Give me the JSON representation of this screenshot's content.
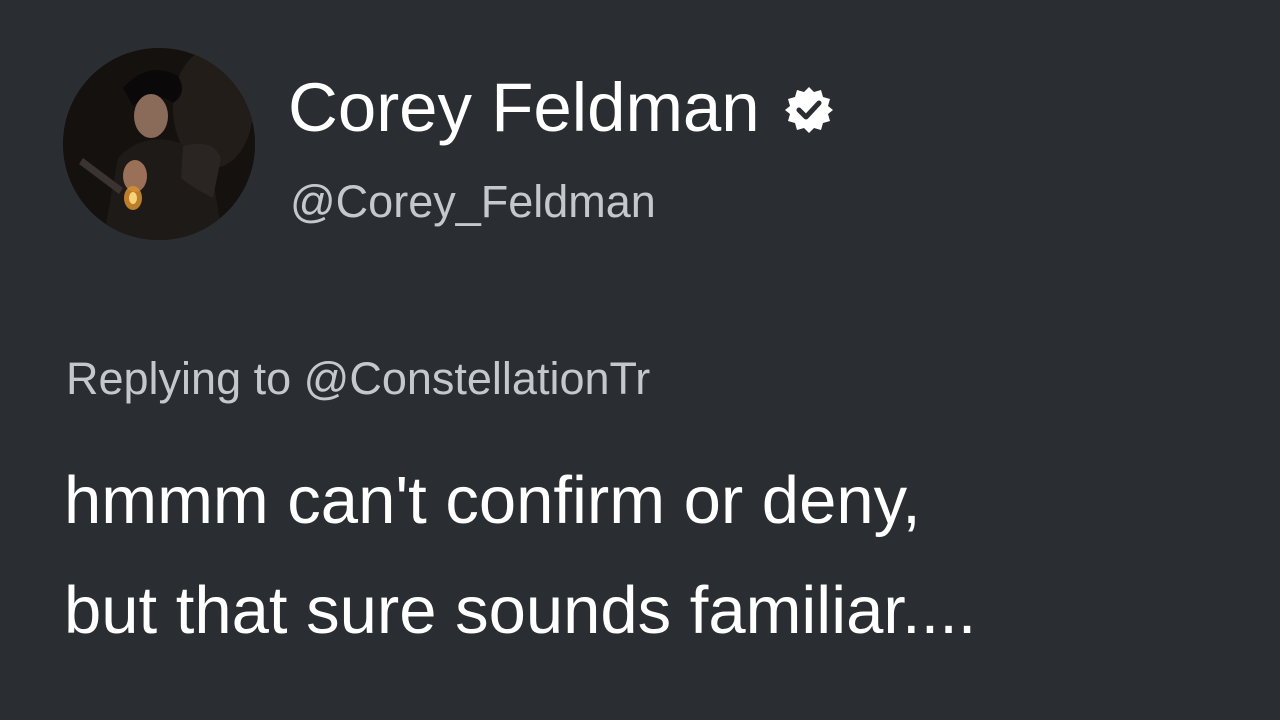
{
  "tweet": {
    "author": {
      "display_name": "Corey Feldman",
      "handle": "@Corey_Feldman",
      "verified": true,
      "verified_icon": "verified-badge-icon",
      "avatar": "profile-photo"
    },
    "reply": {
      "prefix": "Replying to",
      "to_handle": "@ConstellationTr"
    },
    "text_lines": [
      "hmmm can't confirm or deny,",
      "but that sure sounds familiar...."
    ]
  },
  "colors": {
    "background": "#2a2d31",
    "primary_text": "#ffffff",
    "secondary_text": "#c4c8cc"
  }
}
